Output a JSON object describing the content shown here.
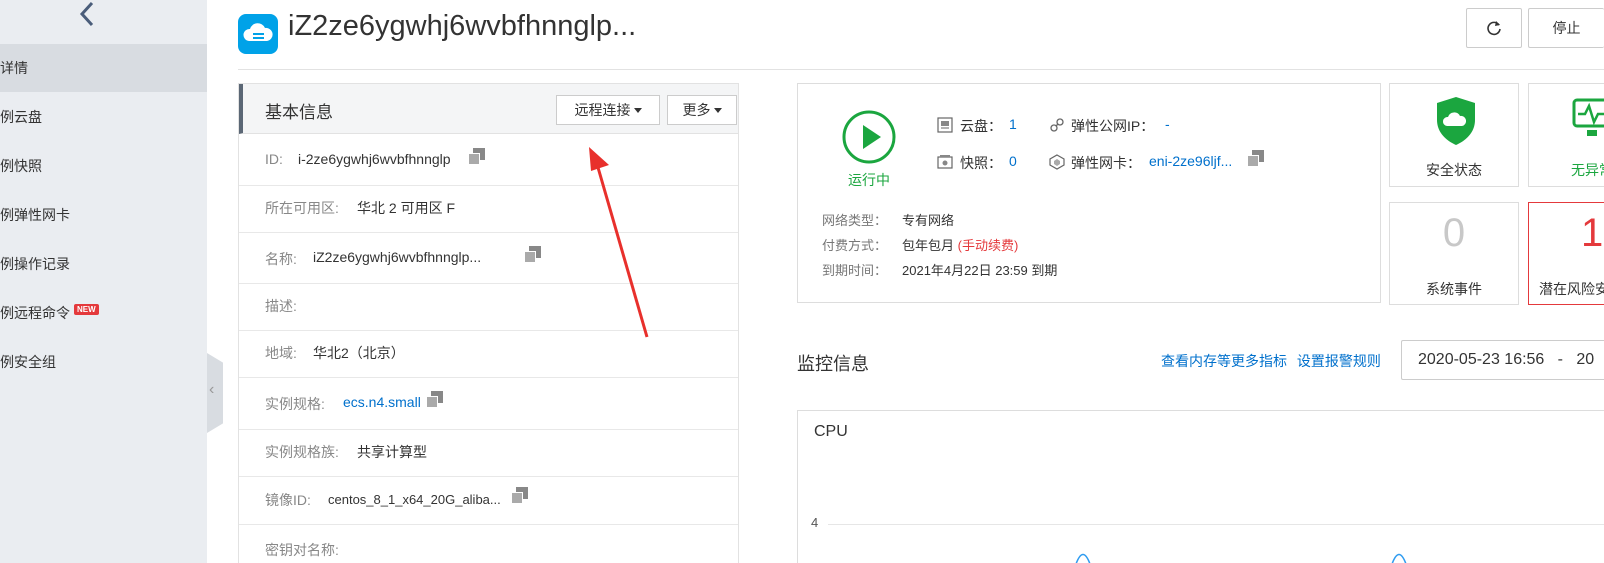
{
  "sidebar": {
    "items": [
      {
        "label": "详情",
        "active": true
      },
      {
        "label": "例云盘"
      },
      {
        "label": "例快照"
      },
      {
        "label": "例弹性网卡"
      },
      {
        "label": "例操作记录"
      },
      {
        "label": "例远程命令",
        "badge": "NEW"
      },
      {
        "label": "例安全组"
      }
    ]
  },
  "header": {
    "title": "iZ2ze6ygwhj6wvbfhnnglp...",
    "stop_label": "停止",
    "icon": "cloud-server-icon",
    "refresh_icon": "refresh-icon"
  },
  "basic_info": {
    "title": "基本信息",
    "remote_label": "远程连接",
    "more_label": "更多",
    "rows": [
      {
        "label": "ID:",
        "value": "i-2ze6ygwhj6wvbfhnnglp"
      },
      {
        "label": "所在可用区:",
        "value": "华北 2 可用区 F"
      },
      {
        "label": "名称:",
        "value": "iZ2ze6ygwhj6wvbfhnnglp..."
      },
      {
        "label": "描述:",
        "value": ""
      },
      {
        "label": "地域:",
        "value": "华北2（北京）"
      },
      {
        "label": "实例规格:",
        "value": "ecs.n4.small"
      },
      {
        "label": "实例规格族:",
        "value": "共享计算型"
      },
      {
        "label": "镜像ID:",
        "value": "centos_8_1_x64_20G_aliba..."
      },
      {
        "label": "密钥对名称:",
        "value": ""
      }
    ]
  },
  "status": {
    "state": "运行中",
    "disk_label": "云盘：",
    "disk_value": "1",
    "snapshot_label": "快照：",
    "snapshot_value": "0",
    "eip_label": "弹性公网IP：",
    "eip_value": "-",
    "eni_label": "弹性网卡：",
    "eni_value": "eni-2ze96ljf...",
    "network_label": "网络类型：",
    "network_value": "专有网络",
    "billing_label": "付费方式：",
    "billing_value": "包年包月",
    "billing_note": "(手动续费)",
    "expire_label": "到期时间：",
    "expire_value": "2021年4月22日 23:59 到期"
  },
  "tiles": {
    "security": {
      "label": "安全状态",
      "icon": "shield-cloud-icon"
    },
    "abnormal": {
      "label": "无异常",
      "icon": "monitor-pulse-icon"
    },
    "events": {
      "label": "系统事件",
      "count": "0"
    },
    "risk": {
      "label": "潜在风险安",
      "count": "1"
    }
  },
  "monitoring": {
    "title": "监控信息",
    "link_more_metrics": "查看内存等更多指标",
    "link_alarm_rules": "设置报警规则",
    "date_range": "2020-05-23 16:56   -   20",
    "chart_title": "CPU",
    "y_tick": "4"
  },
  "colors": {
    "accent_blue": "#0070cc",
    "running_green": "#1ba63f",
    "danger_red": "#e4393c",
    "arrow_red": "#e8302c"
  }
}
